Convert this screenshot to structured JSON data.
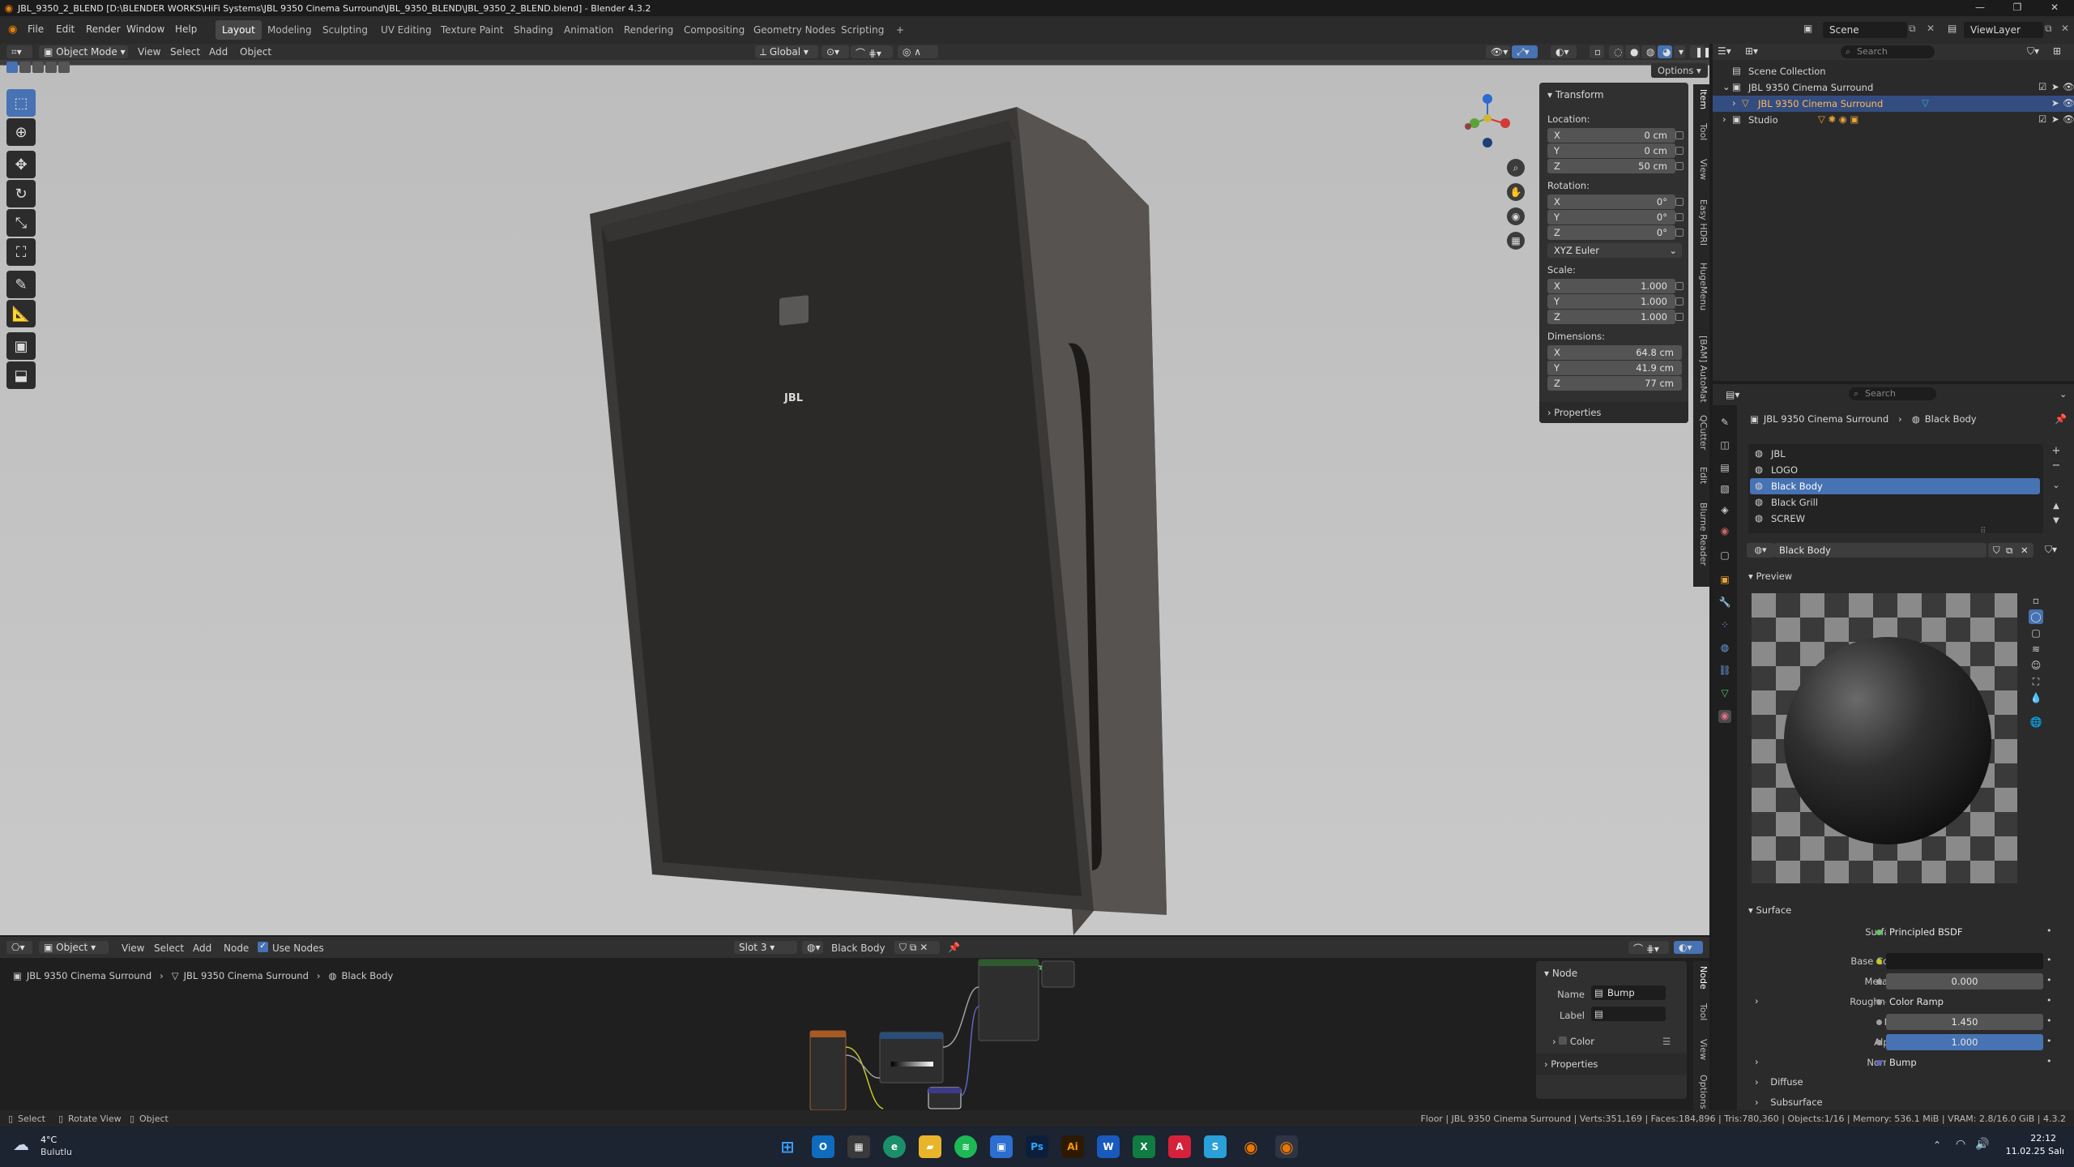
{
  "window": {
    "title": "JBL_9350_2_BLEND [D:\\BLENDER WORKS\\HiFi Systems\\JBL 9350 Cinema Surround\\JBL_9350_BLEND\\JBL_9350_2_BLEND.blend] - Blender 4.3.2"
  },
  "menubar": {
    "items": [
      "File",
      "Edit",
      "Render",
      "Window",
      "Help"
    ],
    "workspaces": [
      "Layout",
      "Modeling",
      "Sculpting",
      "UV Editing",
      "Texture Paint",
      "Shading",
      "Animation",
      "Rendering",
      "Compositing",
      "Geometry Nodes",
      "Scripting"
    ],
    "active_workspace": "Layout",
    "scene_label": "Scene",
    "viewlayer_label": "ViewLayer"
  },
  "viewport_header": {
    "mode": "Object Mode",
    "menus": [
      "View",
      "Select",
      "Add",
      "Object"
    ],
    "orientation": "Global",
    "options": "Options"
  },
  "n_panel": {
    "transform_title": "Transform",
    "location_label": "Location:",
    "location": [
      {
        "axis": "X",
        "value": "0 cm"
      },
      {
        "axis": "Y",
        "value": "0 cm"
      },
      {
        "axis": "Z",
        "value": "50 cm"
      }
    ],
    "rotation_label": "Rotation:",
    "rotation": [
      {
        "axis": "X",
        "value": "0°"
      },
      {
        "axis": "Y",
        "value": "0°"
      },
      {
        "axis": "Z",
        "value": "0°"
      }
    ],
    "rotation_mode": "XYZ Euler",
    "scale_label": "Scale:",
    "scale": [
      {
        "axis": "X",
        "value": "1.000"
      },
      {
        "axis": "Y",
        "value": "1.000"
      },
      {
        "axis": "Z",
        "value": "1.000"
      }
    ],
    "dimensions_label": "Dimensions:",
    "dimensions": [
      {
        "axis": "X",
        "value": "64.8 cm"
      },
      {
        "axis": "Y",
        "value": "41.9 cm"
      },
      {
        "axis": "Z",
        "value": "77 cm"
      }
    ],
    "properties_title": "Properties",
    "side_tabs": [
      "Item",
      "Tool",
      "View",
      "Easy HDRI",
      "HugeMenu",
      "[BAM] AutoMat",
      "QCutter",
      "Edit",
      "Blurne Reader"
    ]
  },
  "speaker_logo": "JBL",
  "node_header": {
    "editor_type": "Object",
    "menus": [
      "View",
      "Select",
      "Add",
      "Node"
    ],
    "use_nodes": "Use Nodes",
    "slot": "Slot 3",
    "material": "Black Body",
    "breadcrumb": [
      "JBL 9350 Cinema Surround",
      "JBL 9350 Cinema Surround",
      "Black Body"
    ]
  },
  "node_npanel": {
    "node_title": "Node",
    "name_label": "Name",
    "name_value": "Bump",
    "label_label": "Label",
    "color_label": "Color",
    "properties_title": "Properties",
    "side_tabs": [
      "Node",
      "Tool",
      "View",
      "Options"
    ]
  },
  "outliner": {
    "search_placeholder": "Search",
    "root": "Scene Collection",
    "rows": [
      "JBL 9350 Cinema Surround",
      "JBL 9350 Cinema Surround",
      "Studio"
    ]
  },
  "properties": {
    "search_placeholder": "Search",
    "breadcrumb": [
      "JBL 9350 Cinema Surround",
      "Black Body"
    ],
    "material_slots": [
      "JBL",
      "LOGO",
      "Black Body",
      "Black Grill",
      "SCREW"
    ],
    "active_slot": "Black Body",
    "material_name": "Black Body",
    "preview_title": "Preview",
    "surface_title": "Surface",
    "surface_fields": [
      {
        "label": "Surface",
        "value": "Principled BSDF",
        "dot": "#63c763"
      },
      {
        "label": "Base Color",
        "value": "",
        "dot": "#c7c729"
      },
      {
        "label": "Metallic",
        "value": "0.000",
        "dot": "#a1a1a1"
      },
      {
        "label": "Roughness",
        "value": "Color Ramp",
        "dot": "#a1a1a1"
      },
      {
        "label": "IOR",
        "value": "1.450",
        "dot": "#a1a1a1"
      },
      {
        "label": "Alpha",
        "value": "1.000",
        "dot": "#a1a1a1"
      },
      {
        "label": "Normal",
        "value": "Bump",
        "dot": "#6363c7"
      }
    ],
    "subsections": [
      "Diffuse",
      "Subsurface"
    ]
  },
  "statusbar": {
    "left": [
      "Select",
      "Rotate View",
      "Object"
    ],
    "right": "Floor | JBL 9350 Cinema Surround | Verts:351,169 | Faces:184,896 | Tris:780,360 | Objects:1/16 | Memory: 536.1 MiB | VRAM: 2.8/16.0 GiB | 4.3.2"
  },
  "taskbar": {
    "weather_temp": "4°C",
    "weather_desc": "Bulutlu",
    "time": "22:12",
    "date": "11.02.25 Salı",
    "apps": [
      "Start",
      "Outlook",
      "Calculator",
      "Edge",
      "Explorer",
      "Spotify",
      "Store",
      "Ps",
      "Ai",
      "Word",
      "Excel",
      "Acrobat",
      "App",
      "Blender",
      "Blender"
    ]
  },
  "colors": {
    "accent": "#4772b3",
    "selected_row": "#334d80",
    "alpha_bar": "#4772b3"
  }
}
